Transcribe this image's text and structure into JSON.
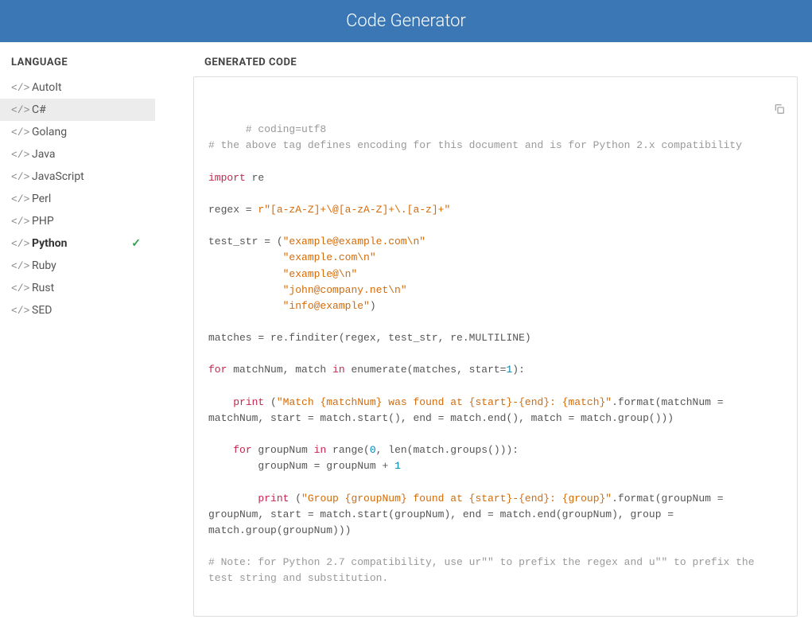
{
  "header": {
    "title": "Code Generator"
  },
  "sidebar": {
    "section_label": "LANGUAGE",
    "items": [
      {
        "label": "AutoIt",
        "selected": false,
        "active": false
      },
      {
        "label": "C#",
        "selected": true,
        "active": false
      },
      {
        "label": "Golang",
        "selected": false,
        "active": false
      },
      {
        "label": "Java",
        "selected": false,
        "active": false
      },
      {
        "label": "JavaScript",
        "selected": false,
        "active": false
      },
      {
        "label": "Perl",
        "selected": false,
        "active": false
      },
      {
        "label": "PHP",
        "selected": false,
        "active": false
      },
      {
        "label": "Python",
        "selected": false,
        "active": true
      },
      {
        "label": "Ruby",
        "selected": false,
        "active": false
      },
      {
        "label": "Rust",
        "selected": false,
        "active": false
      },
      {
        "label": "SED",
        "selected": false,
        "active": false
      }
    ]
  },
  "main": {
    "section_label": "GENERATED CODE"
  },
  "code": {
    "tokens": [
      {
        "t": "# coding=utf8",
        "c": "comment"
      },
      {
        "t": "\n"
      },
      {
        "t": "# the above tag defines encoding for this document and is for Python 2.x compatibility",
        "c": "comment"
      },
      {
        "t": "\n\n"
      },
      {
        "t": "import",
        "c": "keyword"
      },
      {
        "t": " re\n\n"
      },
      {
        "t": "regex = "
      },
      {
        "t": "r\"[a-zA-Z]+\\@[a-zA-Z]+\\.[a-z]+\"",
        "c": "string"
      },
      {
        "t": "\n\n"
      },
      {
        "t": "test_str = ("
      },
      {
        "t": "\"example@example.com\\n\"",
        "c": "string"
      },
      {
        "t": "\n            "
      },
      {
        "t": "\"example.com\\n\"",
        "c": "string"
      },
      {
        "t": "\n            "
      },
      {
        "t": "\"example@\\n\"",
        "c": "string"
      },
      {
        "t": "\n            "
      },
      {
        "t": "\"john@company.net\\n\"",
        "c": "string"
      },
      {
        "t": "\n            "
      },
      {
        "t": "\"info@example\"",
        "c": "string"
      },
      {
        "t": ")\n\n"
      },
      {
        "t": "matches = re.finditer(regex, test_str, re.MULTILINE)\n\n"
      },
      {
        "t": "for",
        "c": "keyword"
      },
      {
        "t": " matchNum, match "
      },
      {
        "t": "in",
        "c": "keyword"
      },
      {
        "t": " enumerate(matches, start="
      },
      {
        "t": "1",
        "c": "number"
      },
      {
        "t": "):\n\n"
      },
      {
        "t": "    "
      },
      {
        "t": "print",
        "c": "keyword"
      },
      {
        "t": " ("
      },
      {
        "t": "\"Match {matchNum} was found at {start}-{end}: {match}\"",
        "c": "string"
      },
      {
        "t": ".format(matchNum = matchNum, start = match.start(), end = match.end(), match = match.group()))\n\n"
      },
      {
        "t": "    "
      },
      {
        "t": "for",
        "c": "keyword"
      },
      {
        "t": " groupNum "
      },
      {
        "t": "in",
        "c": "keyword"
      },
      {
        "t": " range("
      },
      {
        "t": "0",
        "c": "number"
      },
      {
        "t": ", len(match.groups())):\n"
      },
      {
        "t": "        groupNum = groupNum + "
      },
      {
        "t": "1",
        "c": "number"
      },
      {
        "t": "\n\n"
      },
      {
        "t": "        "
      },
      {
        "t": "print",
        "c": "keyword"
      },
      {
        "t": " ("
      },
      {
        "t": "\"Group {groupNum} found at {start}-{end}: {group}\"",
        "c": "string"
      },
      {
        "t": ".format(groupNum = groupNum, start = match.start(groupNum), end = match.end(groupNum), group = match.group(groupNum)))\n\n"
      },
      {
        "t": "# Note: for Python 2.7 compatibility, use ur\"\" to prefix the regex and u\"\" to prefix the test string and substitution.",
        "c": "comment"
      }
    ]
  }
}
